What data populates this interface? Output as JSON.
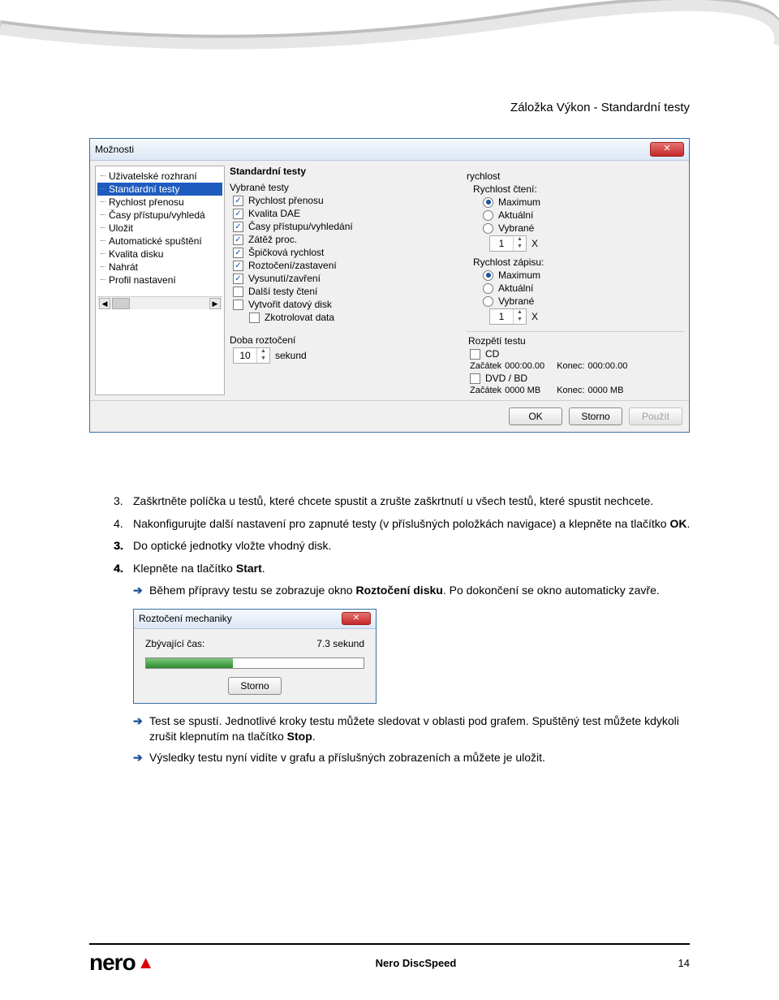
{
  "page_title": "Záložka Výkon - Standardní testy",
  "dialog": {
    "title": "Možnosti",
    "tree": [
      "Uživatelské rozhraní",
      "Standardní testy",
      "Rychlost přenosu",
      "Časy přístupu/vyhledá",
      "Uložit",
      "Automatické spuštění",
      "Kvalita disku",
      "Nahrát",
      "Profil nastavení"
    ],
    "tree_selected_index": 1,
    "section_header": "Standardní testy",
    "selected_tests_label": "Vybrané testy",
    "tests": [
      {
        "label": "Rychlost přenosu",
        "checked": true
      },
      {
        "label": "Kvalita DAE",
        "checked": true
      },
      {
        "label": "Časy přístupu/vyhledání",
        "checked": true
      },
      {
        "label": "Zátěž proc.",
        "checked": true
      },
      {
        "label": "Špičková rychlost",
        "checked": true
      },
      {
        "label": "Roztočení/zastavení",
        "checked": true
      },
      {
        "label": "Vysunutí/zavření",
        "checked": true
      },
      {
        "label": "Další testy čtení",
        "checked": false
      },
      {
        "label": "Vytvořit datový disk",
        "checked": false
      }
    ],
    "verify_data": {
      "label": "Zkotrolovat data",
      "checked": false
    },
    "spinup_label": "Doba roztočení",
    "spinup_value": "10",
    "spinup_unit": "sekund",
    "speed_label": "rychlost",
    "read_label": "Rychlost čtení:",
    "write_label": "Rychlost zápisu:",
    "speed_opts": [
      "Maximum",
      "Aktuální",
      "Vybrané"
    ],
    "read_selected": 0,
    "write_selected": 0,
    "x_val": "1",
    "x_suffix": "X",
    "span_header": "Rozpětí testu",
    "span_cd": {
      "label": "CD",
      "start_lbl": "Začátek",
      "start": "000:00.00",
      "end_lbl": "Konec:",
      "end": "000:00.00"
    },
    "span_dvd": {
      "label": "DVD / BD",
      "start_lbl": "Začátek",
      "start": "0000 MB",
      "end_lbl": "Konec:",
      "end": "0000 MB"
    },
    "btn_ok": "OK",
    "btn_cancel": "Storno",
    "btn_apply": "Použít"
  },
  "steps": {
    "s3": "Zaškrtněte políčka u testů, které chcete spustit a zrušte zaškrtnutí u všech testů, které spustit nechcete.",
    "s4_pre": "Nakonfigurujte další nastavení pro zapnuté testy (v příslušných položkách navigace) a klepněte na tlačítko ",
    "s4_bold": "OK",
    "s4_post": ".",
    "s3b": "Do optické jednotky vložte vhodný disk.",
    "s4b_pre": "Klepněte na tlačítko ",
    "s4b_bold": "Start",
    "s4b_post": ".",
    "note1_pre": "Během přípravy testu se zobrazuje okno ",
    "note1_bold": "Roztočení disku",
    "note1_post": ". Po dokončení se okno automaticky zavře.",
    "note2_pre": "Test se spustí. Jednotlivé kroky testu můžete sledovat v oblasti pod grafem. Spuštěný test můžete kdykoli zrušit klepnutím na tlačítko ",
    "note2_bold": "Stop",
    "note2_post": ".",
    "note3": "Výsledky testu nyní vidíte v grafu a příslušných zobrazeních a můžete je uložit."
  },
  "small_dialog": {
    "title": "Roztočení mechaniky",
    "remaining_label": "Zbývající čas:",
    "remaining_value": "7.3 sekund",
    "cancel": "Storno"
  },
  "footer": {
    "brand": "nero",
    "product": "Nero DiscSpeed",
    "page": "14"
  }
}
